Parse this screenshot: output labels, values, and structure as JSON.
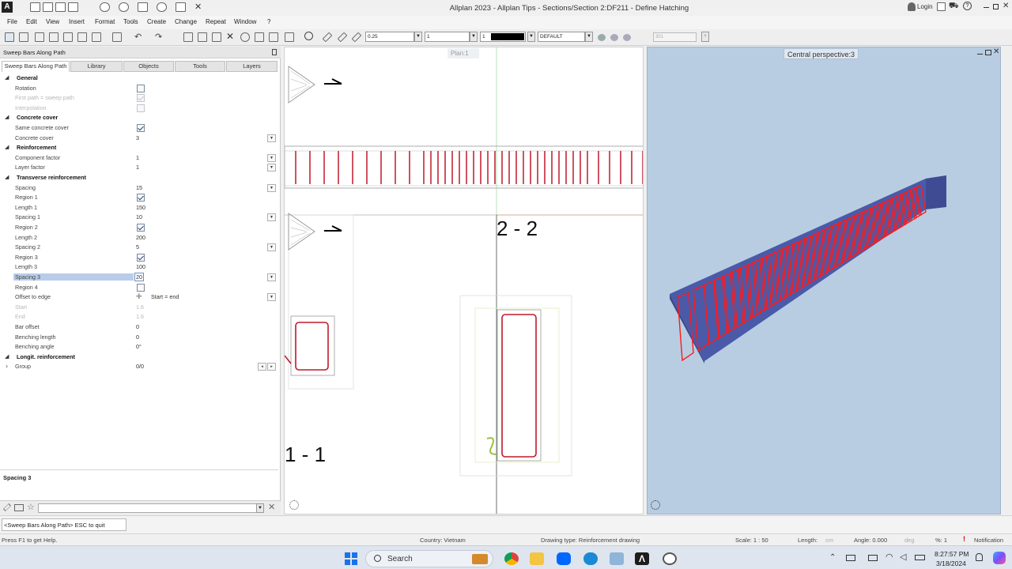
{
  "window": {
    "title": "Allplan 2023 - Allplan Tips - Sections/Section 2:DF211 - Define Hatching",
    "login": "Login"
  },
  "menu": [
    "File",
    "Edit",
    "View",
    "Insert",
    "Format",
    "Tools",
    "Create",
    "Change",
    "Repeat",
    "Window",
    "?"
  ],
  "toolbar": {
    "pen_value": "0.25",
    "line_value": "1",
    "color_value": "1",
    "layer_value": "DEFAULT",
    "scale_field": "301"
  },
  "left_panel": {
    "title": "Sweep Bars Along Path",
    "tabs": [
      "Sweep Bars Along Path",
      "Library",
      "Objects",
      "Tools",
      "Layers"
    ],
    "rows": [
      {
        "type": "section",
        "label": "General"
      },
      {
        "type": "check",
        "label": "Rotation",
        "checked": false
      },
      {
        "type": "check",
        "label": "First path = sweep path",
        "checked": true,
        "disabled": true
      },
      {
        "type": "check",
        "label": "Interpolation",
        "checked": false,
        "disabled": true
      },
      {
        "type": "section",
        "label": "Concrete cover"
      },
      {
        "type": "check",
        "label": "Same concrete cover",
        "checked": true
      },
      {
        "type": "value",
        "label": "Concrete cover",
        "value": "3",
        "dropdown": true
      },
      {
        "type": "section",
        "label": "Reinforcement"
      },
      {
        "type": "value",
        "label": "Component factor",
        "value": "1",
        "dropdown": true
      },
      {
        "type": "value",
        "label": "Layer factor",
        "value": "1",
        "dropdown": true
      },
      {
        "type": "section",
        "label": "Transverse reinforcement"
      },
      {
        "type": "value",
        "label": "Spacing",
        "value": "15",
        "dropdown": true
      },
      {
        "type": "check",
        "label": "Region 1",
        "checked": true
      },
      {
        "type": "value",
        "label": "Length 1",
        "value": "150"
      },
      {
        "type": "value",
        "label": "Spacing 1",
        "value": "10",
        "dropdown": true
      },
      {
        "type": "check",
        "label": "Region 2",
        "checked": true
      },
      {
        "type": "value",
        "label": "Length 2",
        "value": "200"
      },
      {
        "type": "value",
        "label": "Spacing 2",
        "value": "5",
        "dropdown": true
      },
      {
        "type": "check",
        "label": "Region 3",
        "checked": true
      },
      {
        "type": "value",
        "label": "Length 3",
        "value": "100"
      },
      {
        "type": "value",
        "label": "Spacing 3",
        "value": "20",
        "dropdown": true,
        "selected": true
      },
      {
        "type": "check",
        "label": "Region 4",
        "checked": false
      },
      {
        "type": "value",
        "label": "Offset to edge",
        "value": "Start = end",
        "dropdown": true,
        "icon": true
      },
      {
        "type": "value",
        "label": "Start",
        "value": "1.6",
        "disabled": true
      },
      {
        "type": "value",
        "label": "End",
        "value": "1.6",
        "disabled": true
      },
      {
        "type": "value",
        "label": "Bar offset",
        "value": "0"
      },
      {
        "type": "value",
        "label": "Benching length",
        "value": "0"
      },
      {
        "type": "value",
        "label": "Benching angle",
        "value": "0°"
      },
      {
        "type": "section",
        "label": "Longit. reinforcement"
      },
      {
        "type": "group",
        "label": "Group",
        "value": "0/0"
      }
    ],
    "help_title": "Spacing 3"
  },
  "viewport_plan": {
    "label": "Plan:1",
    "section_label_2": "2 - 2",
    "section_label_1": "1 - 1"
  },
  "viewport_3d": {
    "label": "Central perspective:3"
  },
  "command_line": "<Sweep Bars Along Path> ESC to quit",
  "status": {
    "help": "Press F1 to get Help.",
    "country": "Country: Vietnam",
    "drawing_type": "Drawing type: Reinforcement drawing",
    "scale": "Scale: 1 : 50",
    "length": "Length:",
    "length_unit": "cm",
    "angle": "Angle: 0.000",
    "angle_unit": "deg",
    "percent": "%: 1",
    "notification": "Notification"
  },
  "taskbar": {
    "search": "Search",
    "time": "8:27:57 PM",
    "date": "3/18/2024"
  },
  "colors": {
    "rebar": "#c0182a",
    "beam": "#4b5aa8",
    "viewport_bg": "#b8cde2",
    "selection": "#b9cde9"
  }
}
